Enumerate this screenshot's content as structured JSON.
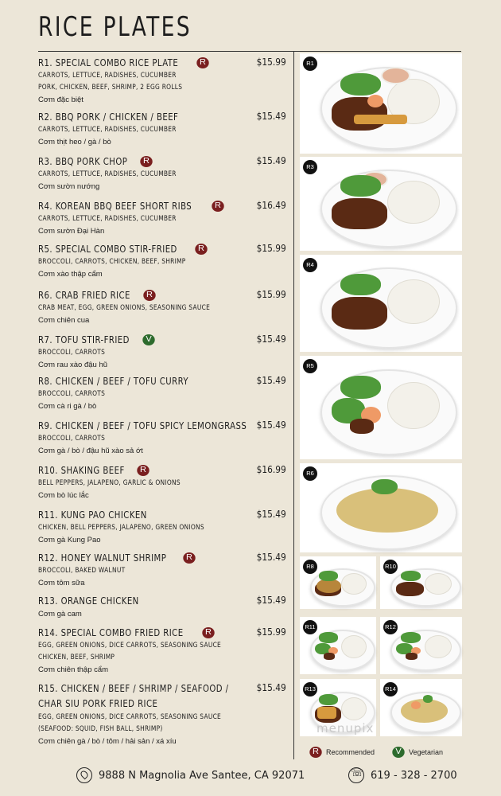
{
  "title": "RICE PLATES",
  "items": [
    {
      "name": "R1. SPECIAL COMBO RICE PLATE",
      "badge": "R",
      "price": "$15.99",
      "desc": [
        "CARROTS, LETTUCE, RADISHES, CUCUMBER",
        "PORK, CHICKEN, BEEF, SHRIMP, 2 EGG ROLLS"
      ],
      "viet": "Cơm đặc biệt"
    },
    {
      "name": "R2. BBQ PORK / CHICKEN / BEEF",
      "badge": "",
      "price": "$15.49",
      "desc": [
        "CARROTS, LETTUCE, RADISHES, CUCUMBER"
      ],
      "viet": "Cơm thịt heo / gà / bò"
    },
    {
      "name": "R3. BBQ PORK CHOP",
      "badge": "R",
      "price": "$15.49",
      "desc": [
        "CARROTS, LETTUCE, RADISHES, CUCUMBER"
      ],
      "viet": "Cơm sườn nướng"
    },
    {
      "name": "R4. KOREAN BBQ BEEF SHORT RIBS",
      "badge": "R",
      "price": "$16.49",
      "desc": [
        "CARROTS, LETTUCE, RADISHES, CUCUMBER"
      ],
      "viet": "Cơm sườn Đại Hàn"
    },
    {
      "name": "R5. SPECIAL COMBO STIR-FRIED",
      "badge": "R",
      "price": "$15.99",
      "desc": [
        "BROCCOLI, CARROTS, CHICKEN, BEEF, SHRIMP"
      ],
      "viet": "Cơm xào thập cẩm"
    },
    {
      "name": "R6. CRAB FRIED RICE",
      "badge": "R",
      "price": "$15.99",
      "desc": [
        "CRAB MEAT, EGG, GREEN ONIONS, SEASONING SAUCE"
      ],
      "viet": "Cơm chiên cua"
    },
    {
      "name": "R7. TOFU STIR-FRIED",
      "badge": "V",
      "price": "$15.49",
      "desc": [
        "BROCCOLI, CARROTS"
      ],
      "viet": "Cơm rau xào đậu hũ"
    },
    {
      "name": "R8. CHICKEN / BEEF / TOFU CURRY",
      "badge": "",
      "price": "$15.49",
      "desc": [
        "BROCCOLI, CARROTS"
      ],
      "viet": "Cơm cà ri gà / bò"
    },
    {
      "name": "R9. CHICKEN / BEEF / TOFU SPICY LEMONGRASS",
      "badge": "",
      "price": "$15.49",
      "desc": [
        "BROCCOLI, CARROTS"
      ],
      "viet": "Cơm gà / bò / đậu hũ xào sả ớt"
    },
    {
      "name": "R10. SHAKING BEEF",
      "badge": "R",
      "price": "$16.99",
      "desc": [
        "BELL PEPPERS, JALAPENO, GARLIC & ONIONS"
      ],
      "viet": "Cơm bò lúc lắc"
    },
    {
      "name": "R11. KUNG PAO CHICKEN",
      "badge": "",
      "price": "$15.49",
      "desc": [
        "CHICKEN, BELL PEPPERS, JALAPENO, GREEN ONIONS"
      ],
      "viet": "Cơm gà Kung Pao"
    },
    {
      "name": "R12. HONEY WALNUT SHRIMP",
      "badge": "R",
      "price": "$15.49",
      "desc": [
        "BROCCOLI, BAKED WALNUT"
      ],
      "viet": "Cơm tôm sữa"
    },
    {
      "name": "R13. ORANGE CHICKEN",
      "badge": "",
      "price": "$15.49",
      "desc": [],
      "viet": "Cơm gà cam"
    },
    {
      "name": "R14. SPECIAL COMBO FRIED RICE",
      "badge": "R",
      "price": "$15.99",
      "desc": [
        "EGG, GREEN ONIONS, DICE CARROTS, SEASONING SAUCE",
        "CHICKEN, BEEF, SHRIMP"
      ],
      "viet": "Cơm chiên thập cẩm"
    },
    {
      "name": "R15. CHICKEN / BEEF / SHRIMP / SEAFOOD /",
      "name2": "CHAR SIU PORK FRIED RICE",
      "badge": "",
      "price": "$15.49",
      "desc": [
        "EGG, GREEN ONIONS, DICE CARROTS, SEASONING SAUCE",
        "(SEAFOOD: SQUID, FISH BALL, SHRIMP)"
      ],
      "viet": "Cơm chiên gà / bò / tôm / hải sản / xá xíu"
    }
  ],
  "photos": [
    {
      "label": "R1",
      "dish": "combo"
    },
    {
      "label": "R3",
      "dish": "porkchop"
    },
    {
      "label": "R4",
      "dish": "shortribs"
    },
    {
      "label": "R5",
      "dish": "stirfry"
    },
    {
      "label": "R6",
      "dish": "friedrice"
    },
    {
      "label": "R8",
      "dish": "curry"
    },
    {
      "label": "R10",
      "dish": "shakingbeef"
    },
    {
      "label": "R11",
      "dish": "kungpao"
    },
    {
      "label": "R12",
      "dish": "walnutshrimp"
    },
    {
      "label": "R13",
      "dish": "orangechicken"
    },
    {
      "label": "R14",
      "dish": "combofriedrice"
    }
  ],
  "legend": {
    "recommended_badge": "R",
    "recommended": "Recommended",
    "vegetarian_badge": "V",
    "vegetarian": "Vegetarian"
  },
  "watermark": "menupix",
  "footer": {
    "address": "9888 N Magnolia Ave Santee, CA 92071",
    "phone": "619 - 328 - 2700"
  },
  "colors": {
    "background": "#ece6d8",
    "recommended": "#7a1f1f",
    "vegetarian": "#2d6b2d"
  }
}
